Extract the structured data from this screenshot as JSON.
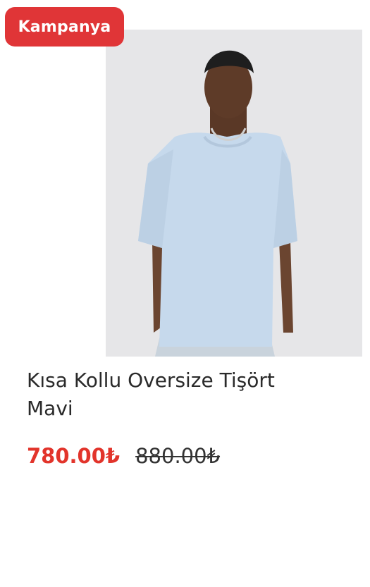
{
  "badge": {
    "label": "Kampanya",
    "color": "#e03537"
  },
  "product": {
    "title": "Kısa Kollu Oversize Tişört Mavi",
    "image": "product-photo-light-blue-oversize-tshirt",
    "price": "780.00₺",
    "old_price": "880.00₺",
    "price_color": "#e2342b"
  }
}
